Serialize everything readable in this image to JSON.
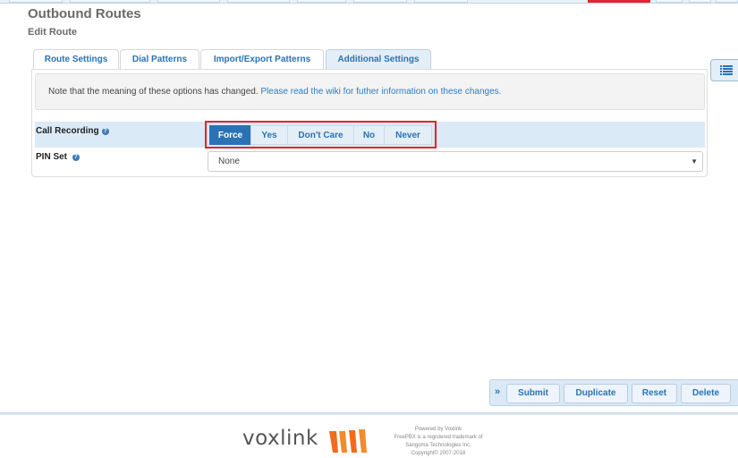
{
  "header": {
    "title": "Outbound Routes",
    "subtitle": "Edit Route"
  },
  "tabs": [
    {
      "label": "Route Settings",
      "active": false
    },
    {
      "label": "Dial Patterns",
      "active": false
    },
    {
      "label": "Import/Export Patterns",
      "active": false
    },
    {
      "label": "Additional Settings",
      "active": true
    }
  ],
  "notice": {
    "text": "Note that the meaning of these options has changed. ",
    "link": "Please read the wiki for futher information on these changes."
  },
  "call_recording": {
    "label": "Call Recording",
    "help_icon": "question-circle-icon",
    "options": [
      "Force",
      "Yes",
      "Don't Care",
      "No",
      "Never"
    ],
    "selected": "Force"
  },
  "pin_set": {
    "label": "PIN Set",
    "help_icon": "question-circle-icon",
    "value": "None"
  },
  "actions": {
    "submit": "Submit",
    "duplicate": "Duplicate",
    "reset": "Reset",
    "delete": "Delete"
  },
  "footer": {
    "brand": "voxlink",
    "powered_by": "Powered by Voxlink",
    "trademark_1": "FreePBX is a registered trademark of",
    "trademark_2": "Sangoma Technologies Inc.",
    "copyright": "Copyright© 2007-2018"
  },
  "colors": {
    "accent": "#2a72b5",
    "highlight": "#e4232e",
    "logo_orange": "#f26b1d"
  }
}
